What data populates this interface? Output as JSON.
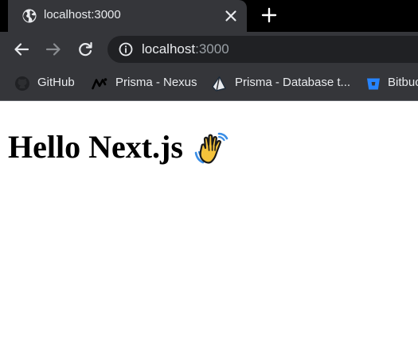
{
  "tab": {
    "title": "localhost:3000",
    "favicon": "globe-icon",
    "close": "close-icon"
  },
  "toolbar": {
    "back": "back-arrow-icon",
    "forward": "forward-arrow-icon",
    "reload": "reload-icon",
    "new_tab": "plus-icon"
  },
  "address_bar": {
    "host": "localhost",
    "port": ":3000",
    "security_icon": "info-icon"
  },
  "bookmarks": [
    {
      "label": "GitHub",
      "icon": "github-icon"
    },
    {
      "label": "Prisma - Nexus",
      "icon": "nexus-icon"
    },
    {
      "label": "Prisma - Database t...",
      "icon": "prisma-icon"
    },
    {
      "label": "Bitbuc",
      "icon": "bitbucket-icon"
    }
  ],
  "page": {
    "heading": "Hello Next.js",
    "emoji": "waving-hand-icon"
  },
  "colors": {
    "tab_strip": "#000000",
    "toolbar": "#35363a",
    "omnibox": "#202124",
    "text_light": "#e8eaed",
    "text_muted": "#9aa0a6",
    "bitbucket_blue": "#2684ff",
    "emoji_yellow": "#f5c33b"
  }
}
